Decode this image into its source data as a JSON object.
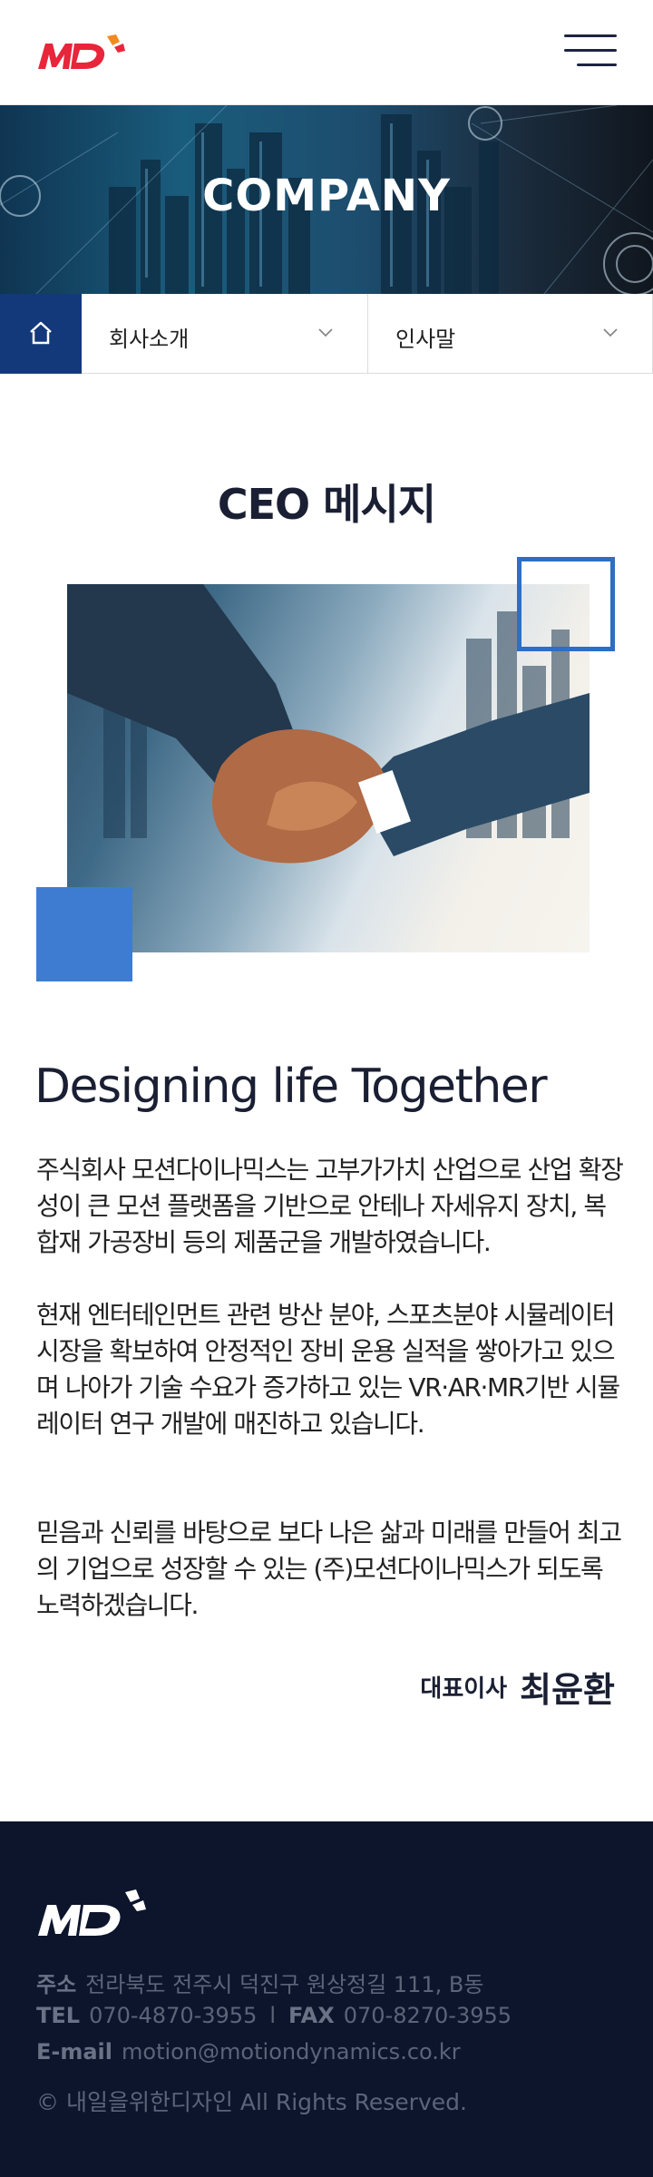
{
  "header": {
    "logo_text": "MD",
    "menu_icon": "hamburger-menu-icon"
  },
  "hero": {
    "title": "COMPANY"
  },
  "subnav": {
    "home_icon": "home-icon",
    "dropdown1": "회사소개",
    "dropdown2": "인사말",
    "chevron_icon": "chevron-down-icon"
  },
  "ceo": {
    "section_title": "CEO 메시지",
    "tagline": "Designing life Together",
    "paragraphs": [
      "주식회사 모션다이나믹스는 고부가가치 산업으로 산업 확장성이 큰 모션 플랫폼을 기반으로 안테나 자세유지 장치, 복합재 가공장비 등의 제품군을 개발하였습니다.",
      "현재 엔터테인먼트 관련 방산 분야, 스포츠분야 시뮬레이터 시장을 확보하여 안정적인 장비 운용 실적을 쌓아가고 있으며 나아가 기술 수요가 증가하고 있는 VR·AR·MR기반 시뮬레이터 연구 개발에 매진하고 있습니다.",
      "믿음과 신뢰를 바탕으로 보다 나은 삶과 미래를 만들어 최고의 기업으로 성장할 수 있는 (주)모션다이나믹스가 되도록 노력하겠습니다."
    ],
    "sign_title": "대표이사",
    "sign_name": "최윤환"
  },
  "footer": {
    "address_label": "주소",
    "address": "전라북도 전주시 덕진구 원상정길 111, B동",
    "tel_label": "TEL",
    "tel": "070-4870-3955",
    "separator": "l",
    "fax_label": "FAX",
    "fax": "070-8270-3955",
    "email_label": "E-mail",
    "email": "motion@motiondynamics.co.kr",
    "copyright": "© 내일을위한디자인  All Rights Reserved."
  },
  "colors": {
    "brand_red": "#e8253a",
    "brand_orange": "#f28a1e",
    "navy": "#13397a",
    "accent_blue": "#3d7cd1",
    "footer_bg": "#0c152c"
  }
}
